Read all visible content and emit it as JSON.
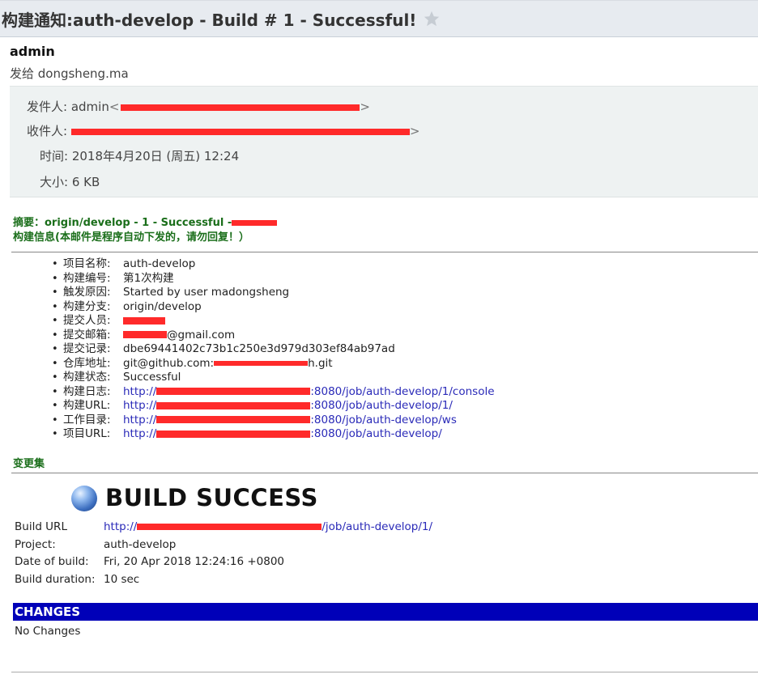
{
  "subject": {
    "title": "构建通知:auth-develop - Build # 1 - Successful!",
    "star_icon": "star-icon"
  },
  "sender": {
    "name": "admin",
    "to_line": "发给 dongsheng.ma"
  },
  "headers": {
    "from_label": "发件人:",
    "from_value": "admin",
    "to_label": "收件人:",
    "time_label": "时间:",
    "time_value": "2018年4月20日 (周五) 12:24",
    "size_label": "大小:",
    "size_value": "6 KB"
  },
  "summary": {
    "line1": "摘要：origin/develop - 1 - Successful -",
    "line2": "构建信息(本邮件是程序自动下发的，请勿回复！）"
  },
  "info": [
    {
      "label": "项目名称:",
      "value": "auth-develop"
    },
    {
      "label": "构建编号:",
      "value": "第1次构建"
    },
    {
      "label": "触发原因:",
      "value": "Started by user madongsheng"
    },
    {
      "label": "构建分支:",
      "value": "origin/develop"
    },
    {
      "label": "提交人员:",
      "value": ""
    },
    {
      "label": "提交邮箱:",
      "value": "@gmail.com"
    },
    {
      "label": "提交记录:",
      "value": "dbe69441402c73b1c250e3d979d303ef84ab97ad"
    },
    {
      "label": "仓库地址:",
      "value_pre": "git@github.com:",
      "value_post": "h.git"
    },
    {
      "label": "构建状态:",
      "value": "Successful"
    },
    {
      "label": "构建日志:",
      "link_pre": "http://",
      "link_post": ":8080/job/auth-develop/1/console"
    },
    {
      "label": "构建URL:",
      "link_pre": "http://",
      "link_post": ":8080/job/auth-develop/1/"
    },
    {
      "label": "工作目录:",
      "link_pre": "http://",
      "link_post": ":8080/job/auth-develop/ws"
    },
    {
      "label": "项目URL:",
      "link_pre": "http://",
      "link_post": ":8080/job/auth-develop/"
    }
  ],
  "changeset_title": "变更集",
  "build": {
    "title": "BUILD SUCCESS",
    "url_label": "Build URL",
    "url_pre": "http://",
    "url_post": "/job/auth-develop/1/",
    "project_label": "Project:",
    "project_value": "auth-develop",
    "date_label": "Date of build:",
    "date_value": "Fri, 20 Apr 2018 12:24:16 +0800",
    "duration_label": "Build duration:",
    "duration_value": "10 sec"
  },
  "changes": {
    "title": "CHANGES",
    "empty_text": "No Changes"
  },
  "colors": {
    "changes_bar": "#0000b8",
    "summary_green": "#1a6e1a",
    "link_blue": "#2a2ab8",
    "redaction": "#ff2a2a"
  }
}
